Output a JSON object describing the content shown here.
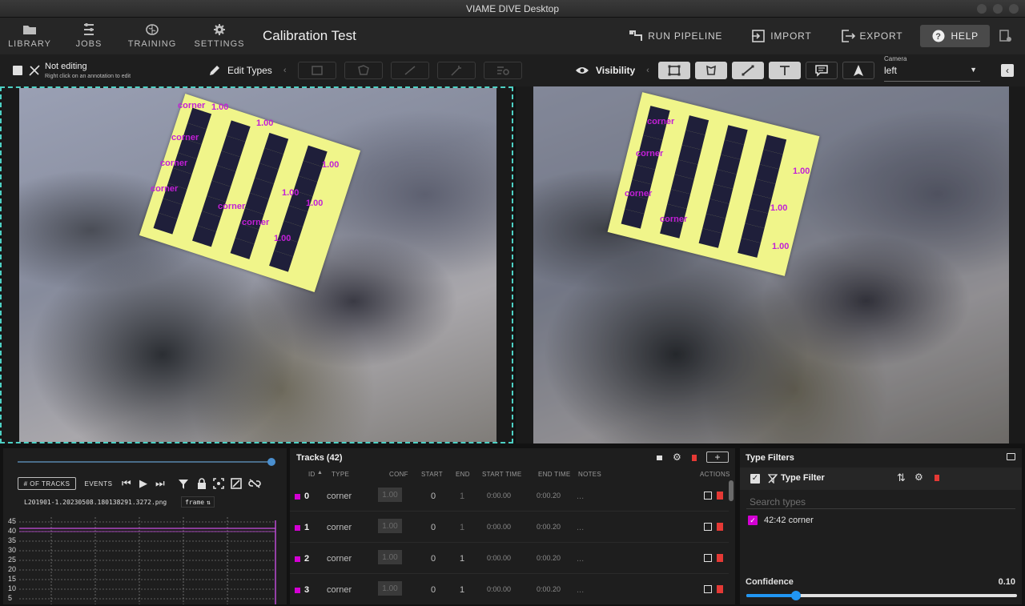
{
  "window": {
    "title": "VIAME DIVE Desktop"
  },
  "nav": {
    "library": "LIBRARY",
    "jobs": "JOBS",
    "training": "TRAINING",
    "settings": "SETTINGS"
  },
  "app_title": "Calibration Test",
  "actions": {
    "run_pipeline": "RUN PIPELINE",
    "import": "IMPORT",
    "export": "EXPORT",
    "help": "HELP"
  },
  "toolbar": {
    "edit_status": "Not editing",
    "edit_hint": "Right click on an annotation to edit",
    "edit_types": "Edit Types",
    "visibility": "Visibility",
    "camera_label": "Camera",
    "camera_value": "left"
  },
  "annotations": {
    "label_text": "corner",
    "conf_text": "1.00"
  },
  "timeline": {
    "num_tracks_btn": "# OF TRACKS",
    "events_btn": "EVENTS",
    "filename": "L201901-1.20230508.180138291.3272.png",
    "frame_label": "frame",
    "y_ticks": [
      "45",
      "40",
      "35",
      "30",
      "25",
      "20",
      "15",
      "10",
      "5"
    ]
  },
  "tracks": {
    "title": "Tracks (42)",
    "columns": {
      "id": "ID",
      "type": "TYPE",
      "conf": "CONF",
      "start": "START",
      "end": "END",
      "start_time": "START TIME",
      "end_time": "END TIME",
      "notes": "NOTES",
      "actions": "ACTIONS"
    },
    "rows": [
      {
        "id": "0",
        "type": "corner",
        "conf": "1.00",
        "start": "0",
        "end": "1",
        "start_time": "0:00.00",
        "end_time": "0:00.20",
        "notes": "..."
      },
      {
        "id": "1",
        "type": "corner",
        "conf": "1.00",
        "start": "0",
        "end": "1",
        "start_time": "0:00.00",
        "end_time": "0:00.20",
        "notes": "..."
      },
      {
        "id": "2",
        "type": "corner",
        "conf": "1.00",
        "start": "0",
        "end": "1",
        "start_time": "0:00.00",
        "end_time": "0:00.20",
        "notes": "..."
      },
      {
        "id": "3",
        "type": "corner",
        "conf": "1.00",
        "start": "0",
        "end": "1",
        "start_time": "0:00.00",
        "end_time": "0:00.20",
        "notes": "..."
      }
    ]
  },
  "type_filters": {
    "title": "Type Filters",
    "filter_label": "Type Filter",
    "search_placeholder": "Search types",
    "items": [
      {
        "label": "42:42 corner",
        "color": "#d400d4"
      }
    ],
    "confidence_label": "Confidence",
    "confidence_value": "0.10",
    "confidence_fraction": 0.1
  },
  "colors": {
    "accent": "#4dd0c4",
    "track": "#d400d4",
    "delete": "#e53935",
    "slider": "#2196f3"
  }
}
